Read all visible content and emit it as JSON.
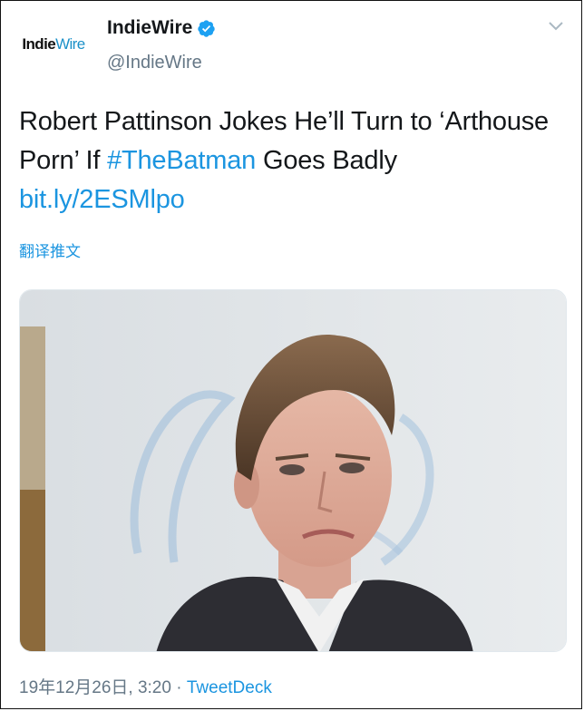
{
  "account": {
    "avatar_text_bold": "Indie",
    "avatar_text_light": "Wire",
    "name": "IndieWire",
    "handle": "@IndieWire"
  },
  "tweet": {
    "text_part1": "Robert Pattinson Jokes He’ll Turn to ‘Arthouse Porn’ If ",
    "hashtag": "#TheBatman",
    "text_part2": " Goes Badly ",
    "link": "bit.ly/2ESMlpo",
    "translate_label": "翻译推文",
    "timestamp": "19年12月26日, 3:20",
    "separator": " · ",
    "source": "TweetDeck"
  },
  "icons": {
    "verified": "verified-badge-icon",
    "menu": "chevron-down-icon"
  },
  "colors": {
    "link": "#1b95e0",
    "secondary_text": "#657786",
    "primary_text": "#14171a"
  }
}
